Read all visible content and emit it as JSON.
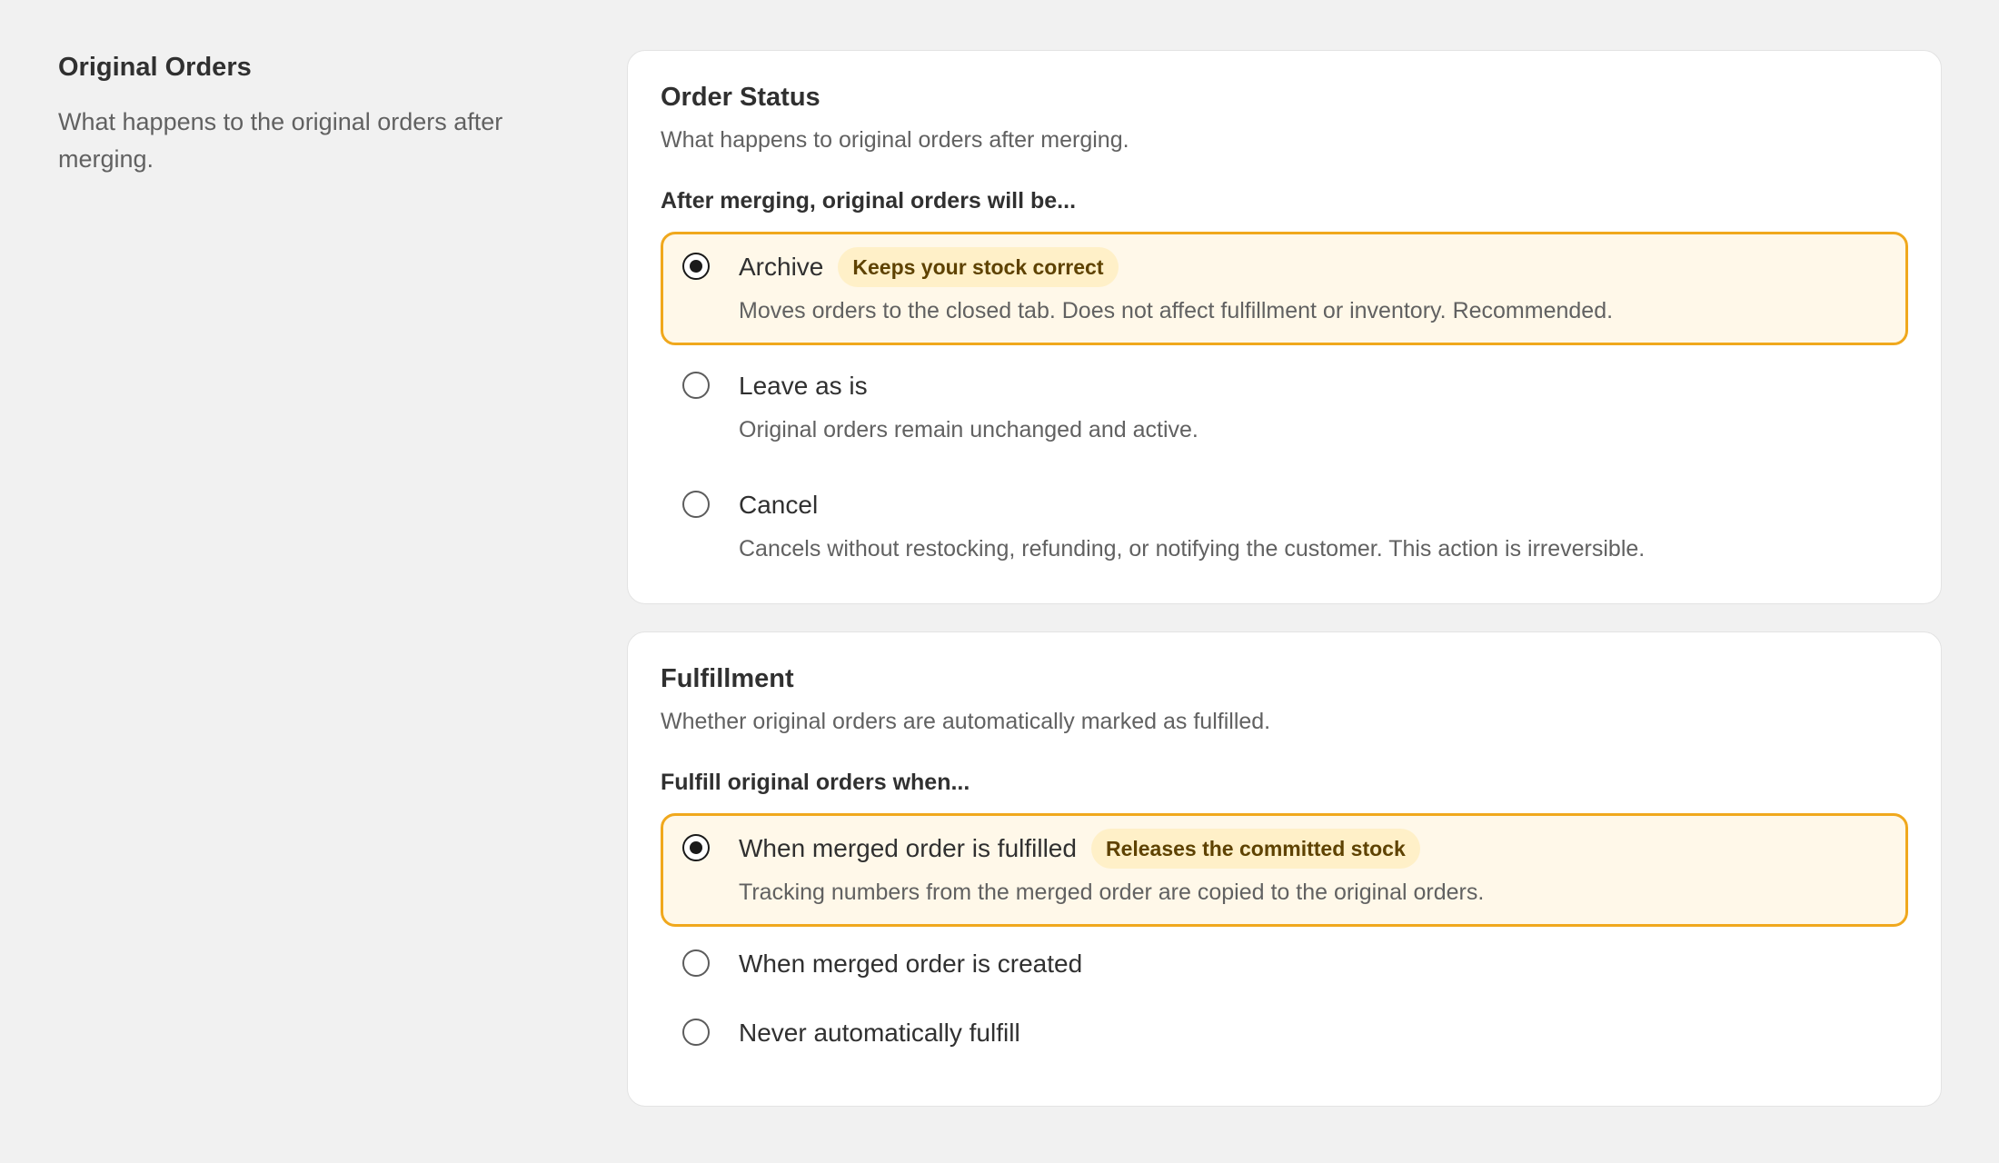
{
  "section": {
    "title": "Original Orders",
    "description": "What happens to the original orders after merging."
  },
  "order_status": {
    "title": "Order Status",
    "description": "What happens to original orders after merging.",
    "group_label": "After merging, original orders will be...",
    "options": [
      {
        "label": "Archive",
        "badge": "Keeps your stock correct",
        "description": "Moves orders to the closed tab. Does not affect fulfillment or inventory. Recommended.",
        "selected": true
      },
      {
        "label": "Leave as is",
        "description": "Original orders remain unchanged and active.",
        "selected": false
      },
      {
        "label": "Cancel",
        "description": "Cancels without restocking, refunding, or notifying the customer. This action is irreversible.",
        "selected": false
      }
    ]
  },
  "fulfillment": {
    "title": "Fulfillment",
    "description": "Whether original orders are automatically marked as fulfilled.",
    "group_label": "Fulfill original orders when...",
    "options": [
      {
        "label": "When merged order is fulfilled",
        "badge": "Releases the committed stock",
        "description": "Tracking numbers from the merged order are copied to the original orders.",
        "selected": true
      },
      {
        "label": "When merged order is created",
        "selected": false
      },
      {
        "label": "Never automatically fulfill",
        "selected": false
      }
    ]
  },
  "colors": {
    "page_background": "#f1f1f1",
    "card_background": "#ffffff",
    "selected_border": "#f0a81d",
    "selected_background": "#fff8e9",
    "badge_background": "#fff0c8",
    "badge_text": "#5e4200"
  }
}
